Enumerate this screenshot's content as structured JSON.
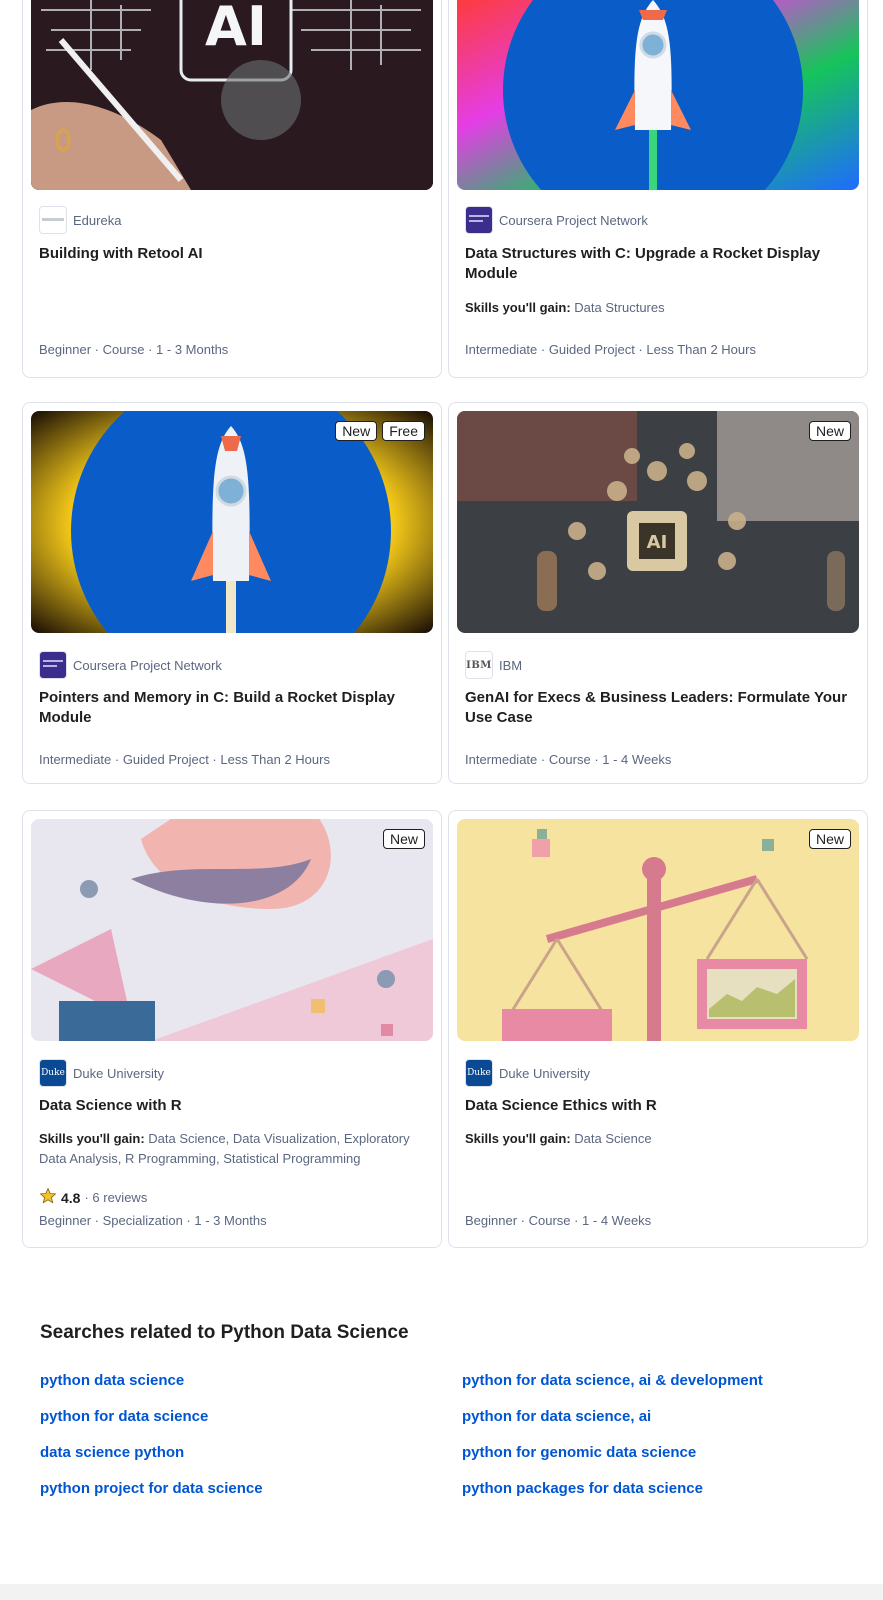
{
  "cards": [
    {
      "partner": "Edureka",
      "title": "Building with Retool AI",
      "skills_label": "",
      "skills": "",
      "meta": "Beginner · Course · 1 - 3 Months",
      "badges": []
    },
    {
      "partner": "Coursera Project Network",
      "title": "Data Structures with C: Upgrade a Rocket Display Module",
      "skills_label": "Skills you'll gain:",
      "skills": "Data Structures",
      "meta": "Intermediate · Guided Project · Less Than 2 Hours",
      "badges": []
    },
    {
      "partner": "Coursera Project Network",
      "title": "Pointers and Memory in C: Build a Rocket Display Module",
      "skills_label": "",
      "skills": "",
      "meta": "Intermediate · Guided Project · Less Than 2 Hours",
      "badges": [
        "New",
        "Free"
      ]
    },
    {
      "partner": "IBM",
      "title": "GenAI for Execs & Business Leaders: Formulate Your Use Case",
      "skills_label": "",
      "skills": "",
      "meta": "Intermediate · Course · 1 - 4 Weeks",
      "badges": [
        "New"
      ]
    },
    {
      "partner": "Duke University",
      "title": "Data Science with R",
      "skills_label": "Skills you'll gain:",
      "skills": "Data Science, Data Visualization, Exploratory Data Analysis, R Programming, Statistical Programming",
      "rating": "4.8",
      "reviews": "· 6 reviews",
      "meta": "Beginner · Specialization · 1 - 3 Months",
      "badges": [
        "New"
      ]
    },
    {
      "partner": "Duke University",
      "title": "Data Science Ethics with R",
      "skills_label": "Skills you'll gain:",
      "skills": "Data Science",
      "meta": "Beginner · Course · 1 - 4 Weeks",
      "badges": [
        "New"
      ]
    }
  ],
  "related": {
    "title": "Searches related to Python Data Science",
    "links": [
      "python data science",
      "python for data science, ai & development",
      "python for data science",
      "python for data science, ai",
      "data science python",
      "python for genomic data science",
      "python project for data science",
      "python packages for data science"
    ]
  },
  "logos": {
    "ibm": "IBM",
    "duke": "Duke"
  },
  "colors": {
    "link": "#0056d2",
    "muted": "#5b6780",
    "border": "#dde2ea"
  }
}
